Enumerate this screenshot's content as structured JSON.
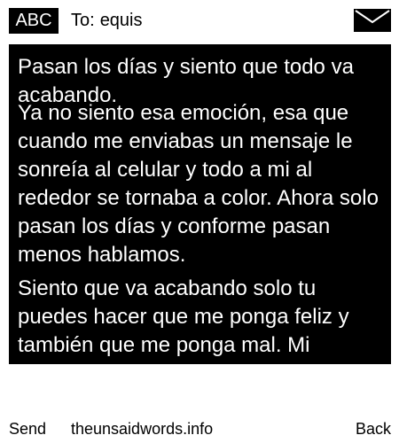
{
  "header": {
    "input_mode": "ABC",
    "to_label": "To:",
    "recipient": "equis",
    "mail_icon": "envelope-icon"
  },
  "message": {
    "paragraphs": [
      "Pasan los días y siento que todo va acabando.",
      "Ya no siento esa emoción, esa que cuando me enviabas un mensaje le sonreía al celular y todo a mi al rededor se tornaba a color. Ahora solo pasan los días y conforme pasan menos hablamos.",
      "Siento que va acabando solo tu puedes hacer que me ponga feliz y también que me ponga mal. Mi"
    ]
  },
  "footer": {
    "send_label": "Send",
    "site_label": "theunsaidwords.info",
    "back_label": "Back"
  },
  "colors": {
    "background": "#ffffff",
    "message_background": "#000000",
    "message_text": "#ffffff"
  }
}
